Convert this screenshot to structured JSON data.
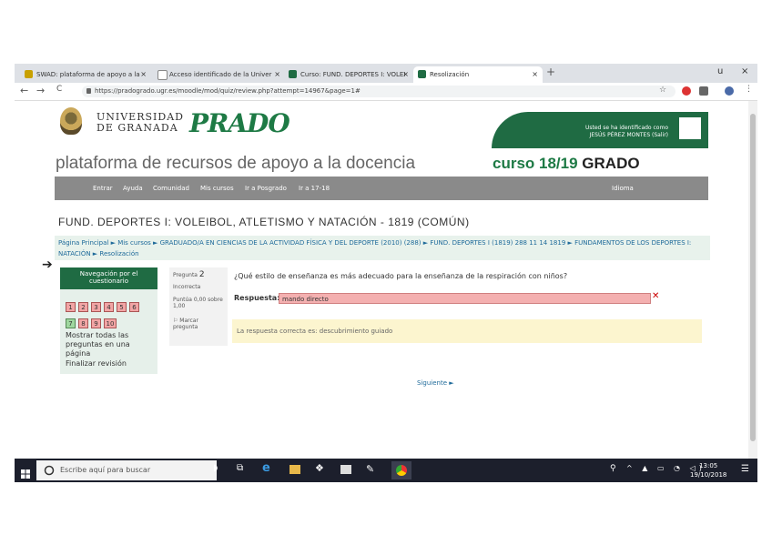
{
  "browser": {
    "tabs": [
      {
        "label": "SWAD: plataforma de apoyo a la",
        "close": "×"
      },
      {
        "label": "Acceso identificado de la Univer",
        "close": "×"
      },
      {
        "label": "Curso: FUND. DEPORTES I: VOLEI",
        "close": "×"
      },
      {
        "label": "Resolización",
        "close": "×",
        "active": true
      }
    ],
    "new_tab": "+",
    "window_controls": [
      "u",
      "×"
    ],
    "back": "←",
    "forward": "→",
    "reload": "C",
    "url": "https://pradogrado.ugr.es/moodle/mod/quiz/review.php?attempt=14967&page=1#",
    "star": "☆"
  },
  "site": {
    "university": [
      "UNIVERSIDAD",
      "DE GRANADA"
    ],
    "logo_text": "PRADO",
    "user_line1": "Usted se ha identificado como",
    "user_line2": "JESÚS PÉREZ MONTES (Salir)",
    "platform_title": "plataforma de recursos de apoyo a la docencia",
    "curso_label": "curso 18/19",
    "curso_grado": "GRADO",
    "menu": [
      "Entrar",
      "Ayuda",
      "Comunidad",
      "Mis cursos",
      "Ir a Posgrado",
      "Ir a 17-18"
    ],
    "menu_right": "Idioma"
  },
  "course": {
    "title": "FUND. DEPORTES I: VOLEIBOL, ATLETISMO Y NATACIÓN - 1819 (COMÚN)",
    "breadcrumbs": "Página Principal ► Mis cursos ► GRADUADO/A EN CIENCIAS DE LA ACTIVIDAD FÍSICA Y DEL DEPORTE (2010) (288) ► FUND. DEPORTES I (1819) 288 11 14 1819 ► FUNDAMENTOS DE LOS DEPORTES I: NATACIÓN ►",
    "breadcrumb_current": "Resolización"
  },
  "quiz_nav": {
    "title": "Navegación por el cuestionario",
    "row1": [
      "1",
      "2",
      "3",
      "4",
      "5",
      "6"
    ],
    "row2": [
      "7",
      "8",
      "9",
      "10"
    ],
    "show_all": "Mostrar todas las preguntas en una página",
    "finish": "Finalizar revisión"
  },
  "question": {
    "number_label": "Pregunta",
    "number": "2",
    "status": "Incorrecta",
    "score": "Puntúa 0,00 sobre 1,00",
    "flag": "Marcar pregunta",
    "text": "¿Qué estilo de enseñanza es más adecuado para la enseñanza de la respiración con niños?",
    "answer_label": "Respuesta:",
    "answer_value": "mando directo",
    "wrong_mark": "✕",
    "feedback": "La respuesta correcta es: descubrimiento guiado"
  },
  "next_link": "Siguiente ►",
  "taskbar": {
    "search_placeholder": "Escribe aquí para buscar",
    "time": "13:05",
    "date": "19/10/2018"
  },
  "colors": {
    "prado_green": "#1f6b43",
    "wrong_fill": "#f4b0b0",
    "feedback_fill": "#fcf5cf",
    "nav_gray": "#8a8a8a"
  }
}
